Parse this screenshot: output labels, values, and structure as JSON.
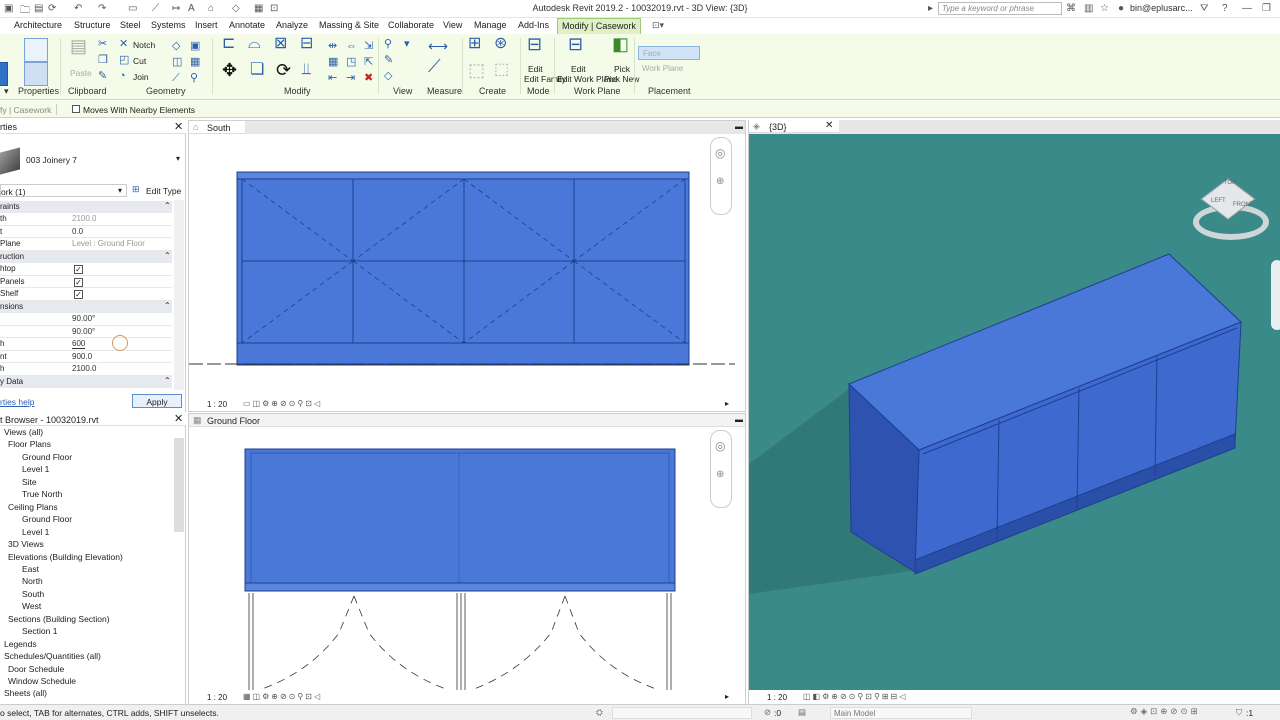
{
  "titlebar": {
    "title": "Autodesk Revit 2019.2 - 10032019.rvt - 3D View: {3D}",
    "search_placeholder": "Type a keyword or phrase",
    "user": "bin@eplusarc..."
  },
  "tabs": [
    "Architecture",
    "Structure",
    "Steel",
    "Systems",
    "Insert",
    "Annotate",
    "Analyze",
    "Massing & Site",
    "Collaborate",
    "View",
    "Manage",
    "Add-Ins",
    "Modify | Casework"
  ],
  "ribbon": {
    "panels": [
      "Properties",
      "Clipboard",
      "Geometry",
      "Modify",
      "View",
      "Measure",
      "Create",
      "Mode",
      "Work Plane",
      "Placement"
    ],
    "tools": {
      "paste": "Paste",
      "notch": "Notch",
      "cut": "Cut",
      "join": "Join",
      "edit_family": "Edit Family",
      "edit_work_plane": "Edit Work Plane",
      "pick_new": "Pick New",
      "face": "Face",
      "work_plane": "Work Plane"
    }
  },
  "optionbar": {
    "context": "fy | Casework",
    "moves_with": "Moves With Nearby Elements"
  },
  "properties": {
    "title": "rties",
    "type_name": "003 Joinery 7",
    "instance": "ork (1)",
    "edit_type": "Edit Type",
    "apply": "Apply",
    "help": "rties help",
    "groups": [
      "raints",
      "ruction",
      "nsions",
      "y Data"
    ],
    "rows": [
      {
        "k": "th",
        "v": "2100.0",
        "grey": true
      },
      {
        "k": "t",
        "v": "0.0",
        "grey": false
      },
      {
        "k": "Plane",
        "v": "Level : Ground Floor",
        "grey": true
      },
      {
        "k": "htop",
        "v": "check"
      },
      {
        "k": "Panels",
        "v": "check"
      },
      {
        "k": "Shelf",
        "v": "check"
      },
      {
        "k": "",
        "v": "90.00°"
      },
      {
        "k": "",
        "v": "90.00°"
      },
      {
        "k": "h",
        "v": "600"
      },
      {
        "k": "nt",
        "v": "900.0"
      },
      {
        "k": "h",
        "v": "2100.0"
      }
    ]
  },
  "browser": {
    "title": "t Browser - 10032019.rvt",
    "items": [
      {
        "t": "Views (all)",
        "i": 1
      },
      {
        "t": "Floor Plans",
        "i": 2
      },
      {
        "t": "Ground Floor",
        "i": 3
      },
      {
        "t": "Level 1",
        "i": 3
      },
      {
        "t": "Site",
        "i": 3
      },
      {
        "t": "True North",
        "i": 3
      },
      {
        "t": "Ceiling Plans",
        "i": 2
      },
      {
        "t": "Ground Floor",
        "i": 3
      },
      {
        "t": "Level 1",
        "i": 3
      },
      {
        "t": "3D Views",
        "i": 2
      },
      {
        "t": "Elevations (Building Elevation)",
        "i": 2
      },
      {
        "t": "East",
        "i": 3
      },
      {
        "t": "North",
        "i": 3
      },
      {
        "t": "South",
        "i": 3
      },
      {
        "t": "West",
        "i": 3
      },
      {
        "t": "Sections (Building Section)",
        "i": 2
      },
      {
        "t": "Section 1",
        "i": 3
      },
      {
        "t": "Legends",
        "i": 1
      },
      {
        "t": "Schedules/Quantities (all)",
        "i": 1
      },
      {
        "t": "Door Schedule",
        "i": 2
      },
      {
        "t": "Window Schedule",
        "i": 2
      },
      {
        "t": "Sheets (all)",
        "i": 1
      }
    ]
  },
  "views": {
    "south": {
      "title": "South",
      "scale": "1 : 20"
    },
    "ground": {
      "title": "Ground Floor",
      "scale": "1 : 20"
    },
    "threed": {
      "title": "{3D}",
      "scale": "1 : 20"
    }
  },
  "viewcube": {
    "top": "TOP",
    "left": "LEFT",
    "front": "FRONT"
  },
  "status": {
    "hint": "o select, TAB for alternates, CTRL adds, SHIFT unselects.",
    "coord": ":0",
    "model": "Main Model",
    "filter": ":1"
  },
  "colors": {
    "ribbon": "#f4fbe9",
    "selection": "#4a78d8",
    "bg3d": "#3a8a8a"
  }
}
